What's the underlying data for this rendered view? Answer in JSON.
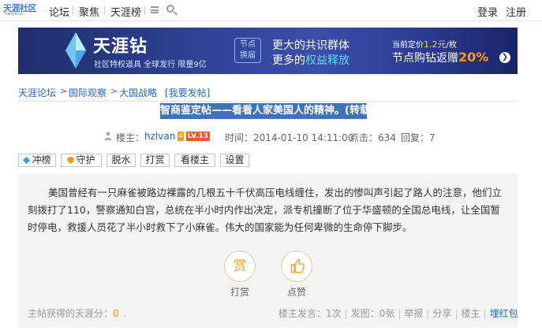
{
  "nav": {
    "logo_text": "天涯社区",
    "logo_sub": "tianya.cn",
    "links": [
      "论坛",
      "聚焦",
      "天涯榜"
    ],
    "login": "登录",
    "register": "注册"
  },
  "banner": {
    "title": "天涯钻",
    "subtitle": "社区特权道具 全球发行 限量9亿",
    "badge_line1": "节点",
    "badge_line2": "换届",
    "mid_line1": "更大的共识群体",
    "mid_line2_a": "更多的",
    "mid_line2_b": "权益释放",
    "price_label": "当前定价",
    "price_value": "1.2元",
    "price_unit": "/枚",
    "promo_label": "节点购钻返赠",
    "promo_value": "20%"
  },
  "breadcrumb": {
    "items": [
      "天涯论坛",
      "国际观察",
      "大国战略"
    ],
    "separator": ">",
    "post_link": "[我要发帖]"
  },
  "post": {
    "title": "智商鉴定帖——看看人家美国人的精神。(转载)",
    "owner_label": "楼主：",
    "author": "hzlvan",
    "badge_num": "4",
    "level": "LV.13",
    "time": "时间：2014-01-10 14:11:00",
    "clicks": "点击：634",
    "replies": "回复：7",
    "body": "美国曾经有一只麻雀被路边裸露的几根五十千伏高压电线缠住，发出的惨叫声引起了路人的注意，他们立刻拨打了110，警察通知白宫，总统在半小时内作出决定，派专机撞断了位于华盛顿的全国总电线，让全国暂时停电，救援人员花了半小时救下了小麻雀。伟大的国家能为任何卑微的生命停下脚步。"
  },
  "toolbar": {
    "chongbang": "冲榜",
    "shouhu": "守护",
    "tuoshui": "脱水",
    "dashang": "打赏",
    "kanlouzhu": "看楼主",
    "shezhi": "设置"
  },
  "actions": {
    "reward_icon_text": "赏",
    "reward_label": "打赏",
    "like_label": "点赞"
  },
  "footer": {
    "earned_label": "主帖获得的天涯分：",
    "earned_value": "0",
    "owner_posts": "楼主发言：1次",
    "images": "发图：0张",
    "report": "举报",
    "share": "分享",
    "owner": "楼主",
    "bury": "埋红包"
  },
  "colors": {
    "link_blue": "#2768ba",
    "title_bg": "#3f72b8",
    "orange": "#f39a1e"
  }
}
